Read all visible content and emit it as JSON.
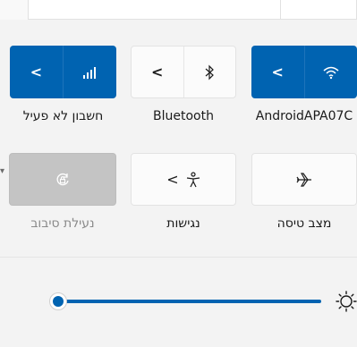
{
  "tiles": {
    "cellular": {
      "label": "חשבון לא פעיל",
      "expand_icon": "chevron-left-icon",
      "icon": "cellular-signal-icon",
      "state": "active"
    },
    "bluetooth": {
      "label": "Bluetooth",
      "expand_icon": "chevron-left-icon",
      "icon": "bluetooth-icon",
      "state": "inactive"
    },
    "wifi": {
      "label": "AndroidAPA07C",
      "expand_icon": "chevron-left-icon",
      "icon": "wifi-icon",
      "state": "active"
    },
    "rotation_lock": {
      "label": "נעילת סיבוב",
      "icon": "rotation-lock-icon",
      "state": "disabled"
    },
    "accessibility": {
      "label": "נגישות",
      "expand_icon": "chevron-left-icon",
      "icon": "accessibility-icon",
      "state": "inactive"
    },
    "airplane": {
      "label": "מצב טיסה",
      "icon": "airplane-icon",
      "state": "inactive"
    }
  },
  "brightness": {
    "value": 0,
    "icon": "brightness-sun-icon"
  },
  "colors": {
    "accent": "#0063b1",
    "tile_light": "#fbfbfb",
    "tile_disabled": "#c4c4c4",
    "background": "#f3f3f3"
  }
}
